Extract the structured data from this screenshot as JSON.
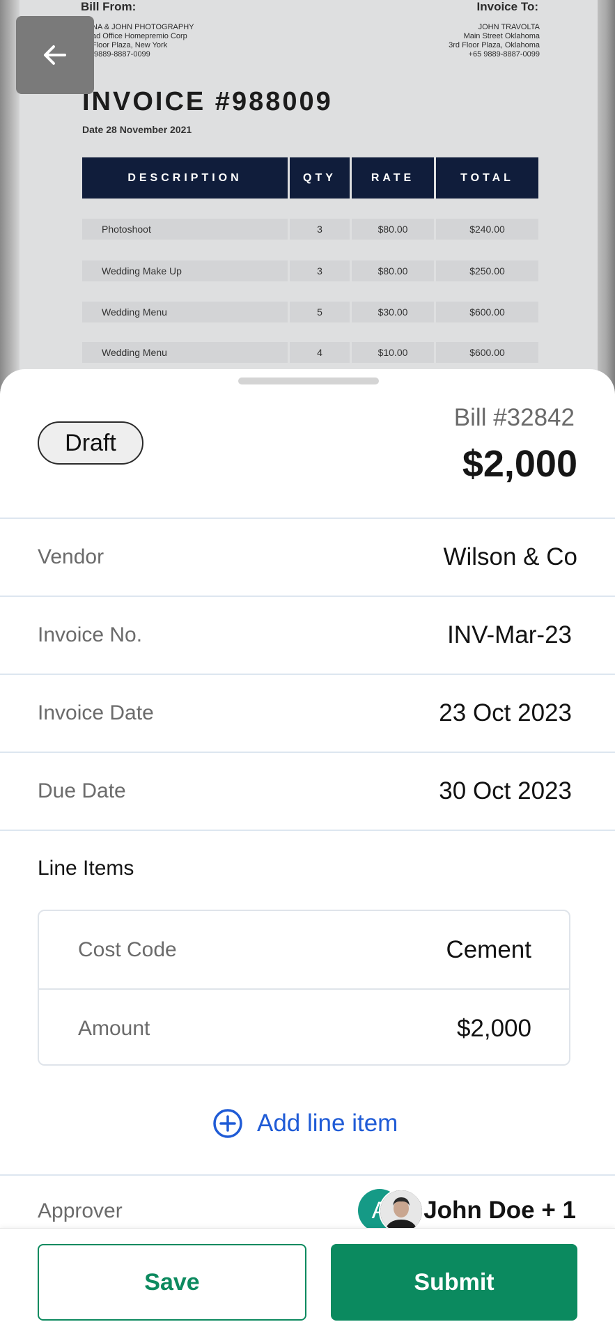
{
  "preview": {
    "bill_from_label": "Bill From:",
    "bill_from_lines": "NA & JOHN PHOTOGRAPHY\nad Office Homepremio Corp\nFloor Plaza, New York\n 9889-8887-0099",
    "invoice_to_label": "Invoice To:",
    "invoice_to_lines": "JOHN TRAVOLTA\nMain Street Oklahoma\n3rd Floor Plaza, Oklahoma\n+65 9889-8887-0099",
    "title": "INVOICE #988009",
    "date": "Date 28 November 2021",
    "columns": [
      "DESCRIPTION",
      "QTY",
      "RATE",
      "TOTAL"
    ],
    "rows": [
      {
        "description": "Photoshoot",
        "qty": "3",
        "rate": "$80.00",
        "total": "$240.00"
      },
      {
        "description": "Wedding Make Up",
        "qty": "3",
        "rate": "$80.00",
        "total": "$250.00"
      },
      {
        "description": "Wedding Menu",
        "qty": "5",
        "rate": "$30.00",
        "total": "$600.00"
      },
      {
        "description": "Wedding Menu",
        "qty": "4",
        "rate": "$10.00",
        "total": "$600.00"
      }
    ]
  },
  "bill": {
    "status": "Draft",
    "number": "Bill #32842",
    "total": "$2,000"
  },
  "fields": [
    {
      "label": "Vendor",
      "value": "Wilson & Co"
    },
    {
      "label": "Invoice No.",
      "value": "INV-Mar-23"
    },
    {
      "label": "Invoice Date",
      "value": "23 Oct 2023"
    },
    {
      "label": "Due Date",
      "value": "30 Oct 2023"
    }
  ],
  "line_items": {
    "title": "Line Items",
    "rows": [
      {
        "label": "Cost Code",
        "value": "Cement"
      },
      {
        "label": "Amount",
        "value": "$2,000"
      }
    ],
    "add_label": "Add line item"
  },
  "approver": {
    "label": "Approver",
    "avatar_initial": "A",
    "value": "John Doe + 1"
  },
  "actions": {
    "save_label": "Save",
    "submit_label": "Submit"
  },
  "colors": {
    "primary_green": "#0b8a5f",
    "link_blue": "#1f5bd6",
    "invoice_header_navy": "#101d3b"
  },
  "icons": {
    "back": "arrow-left-icon",
    "add": "plus-circle-icon"
  }
}
